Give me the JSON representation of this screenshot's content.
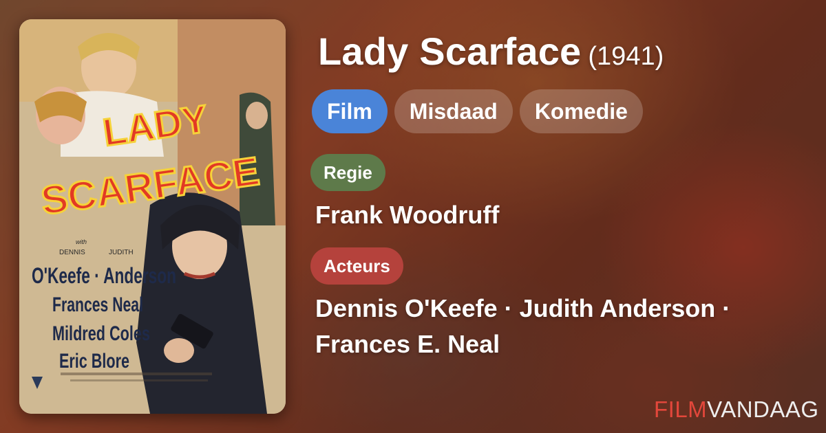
{
  "colors": {
    "genre_active": "#4a84d8",
    "label_regie": "#5e7a4a",
    "label_acteurs": "#b5423c",
    "brand_red": "#e3473b"
  },
  "poster": {
    "title_line1": "LADY",
    "title_line2": "SCARFACE",
    "with_text": "with",
    "credit_first_names": [
      "DENNIS",
      "JUDITH"
    ],
    "credit_line": "O'Keefe · Anderson",
    "cast_lines": [
      "Frances Neal",
      "Mildred Coles",
      "Eric Blore"
    ]
  },
  "movie": {
    "title": "Lady Scarface",
    "year": "(1941)"
  },
  "genres": [
    "Film",
    "Misdaad",
    "Komedie"
  ],
  "director_label": "Regie",
  "director": "Frank Woodruff",
  "actors_label": "Acteurs",
  "actors_line1": "Dennis O'Keefe · Judith Anderson ·",
  "actors_line2": "Frances E. Neal",
  "brand": {
    "part1": "FILM",
    "part2": "VANDAAG"
  }
}
